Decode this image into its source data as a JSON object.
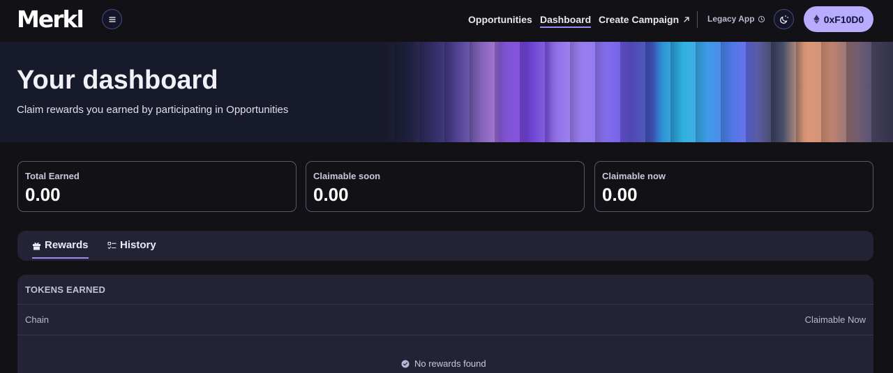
{
  "header": {
    "logo": "Merkl",
    "nav": {
      "opportunities": "Opportunities",
      "dashboard": "Dashboard",
      "create_campaign": "Create Campaign",
      "create_campaign_icon": "arrow-up-right-icon"
    },
    "legacy_app": "Legacy App",
    "legacy_icon": "history-icon",
    "theme_icon": "moon-sun-icon",
    "wallet_label": "0xF10D0",
    "wallet_icon": "ethereum-icon"
  },
  "hero": {
    "title": "Your dashboard",
    "subtitle": "Claim rewards you earned by participating in Opportunities"
  },
  "stats": [
    {
      "label": "Total Earned",
      "value": "0.00"
    },
    {
      "label": "Claimable soon",
      "value": "0.00"
    },
    {
      "label": "Claimable now",
      "value": "0.00"
    }
  ],
  "tabs": [
    {
      "label": "Rewards",
      "icon": "gift-icon",
      "active": true
    },
    {
      "label": "History",
      "icon": "list-checks-icon",
      "active": false
    }
  ],
  "table": {
    "title": "TOKENS EARNED",
    "columns": {
      "chain": "Chain",
      "claimable_now": "Claimable Now"
    },
    "empty_message": "No rewards found"
  },
  "colors": {
    "background": "#121216",
    "accent": "#b8acff",
    "panel": "#222436"
  }
}
